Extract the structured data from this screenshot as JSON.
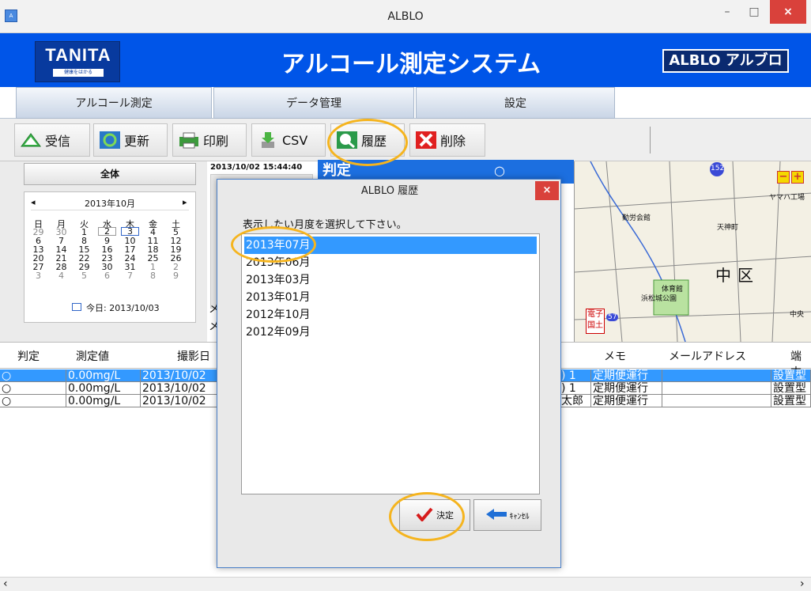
{
  "window": {
    "title": "ALBLO",
    "minimize": "–",
    "maximize": "□",
    "close": "×",
    "app_icon": "A"
  },
  "banner": {
    "logo_text": "TANITA",
    "logo_sub": "健康をはかる",
    "app_title": "アルコール測定システム",
    "badge": "ALBLO アルブロ"
  },
  "tabs": [
    {
      "label": "アルコール測定"
    },
    {
      "label": "データ管理"
    },
    {
      "label": "設定"
    }
  ],
  "toolbar": {
    "receive": "受信",
    "refresh": "更新",
    "print": "印刷",
    "csv": "CSV",
    "history": "履歴",
    "delete": "削除"
  },
  "left_panel": {
    "all_button": "全体",
    "calendar": {
      "title": "2013年10月",
      "prev": "◂",
      "next": "▸",
      "weekdays": [
        "日",
        "月",
        "火",
        "水",
        "木",
        "金",
        "土"
      ],
      "weeks": [
        [
          "29",
          "30",
          "1",
          "2",
          "3",
          "4",
          "5"
        ],
        [
          "6",
          "7",
          "8",
          "9",
          "10",
          "11",
          "12"
        ],
        [
          "13",
          "14",
          "15",
          "16",
          "17",
          "18",
          "19"
        ],
        [
          "20",
          "21",
          "22",
          "23",
          "24",
          "25",
          "26"
        ],
        [
          "27",
          "28",
          "29",
          "30",
          "31",
          "1",
          "2"
        ],
        [
          "3",
          "4",
          "5",
          "6",
          "7",
          "8",
          "9"
        ]
      ],
      "today": "今日: 2013/10/03"
    }
  },
  "detail": {
    "timestamp": "2013/10/02 15:44:40",
    "judge_label": "判定",
    "judge_value": "○",
    "side_label_1": "メ",
    "side_label_2": "メ"
  },
  "map_labels": {
    "route_152": "152",
    "route_57": "57",
    "yamaha": "ヤマハ工場",
    "park": "浜松城公園",
    "gym": "体育館",
    "naka": "中",
    "ku": "区",
    "naka_label": "中央",
    "denshi": "電子国土",
    "tenjin": "天神町",
    "kaikan": "勤労会館",
    "plus": "+",
    "minus": "−"
  },
  "table": {
    "headers": [
      "判定",
      "測定値",
      "撮影日",
      "メモ",
      "メールアドレス",
      "端末"
    ],
    "rows": [
      {
        "judge": "○",
        "value": "0.00mg/L",
        "date": "2013/10/02",
        "name": ") 1",
        "memo": "定期便運行",
        "mail": "",
        "device": "設置型"
      },
      {
        "judge": "○",
        "value": "0.00mg/L",
        "date": "2013/10/02",
        "name": ") 1",
        "memo": "定期便運行",
        "mail": "",
        "device": "設置型"
      },
      {
        "judge": "○",
        "value": "0.00mg/L",
        "date": "2013/10/02",
        "name": "太郎",
        "memo": "定期便運行",
        "mail": "",
        "device": "設置型"
      }
    ]
  },
  "scrollbar": {
    "left": "‹",
    "right": "›"
  },
  "modal": {
    "title": "ALBLO 履歴",
    "close": "×",
    "prompt": "表示したい月度を選択して下さい。",
    "months": [
      "2013年07月",
      "2013年06月",
      "2013年03月",
      "2013年01月",
      "2012年10月",
      "2012年09月"
    ],
    "selected_index": 0,
    "ok_label": "決定",
    "cancel_label": "ｷｬﾝｾﾙ"
  },
  "colors": {
    "banner": "#0055e8",
    "selection": "#3399ff",
    "highlight_oval": "#f5b41e",
    "close_red": "#d9413b"
  }
}
